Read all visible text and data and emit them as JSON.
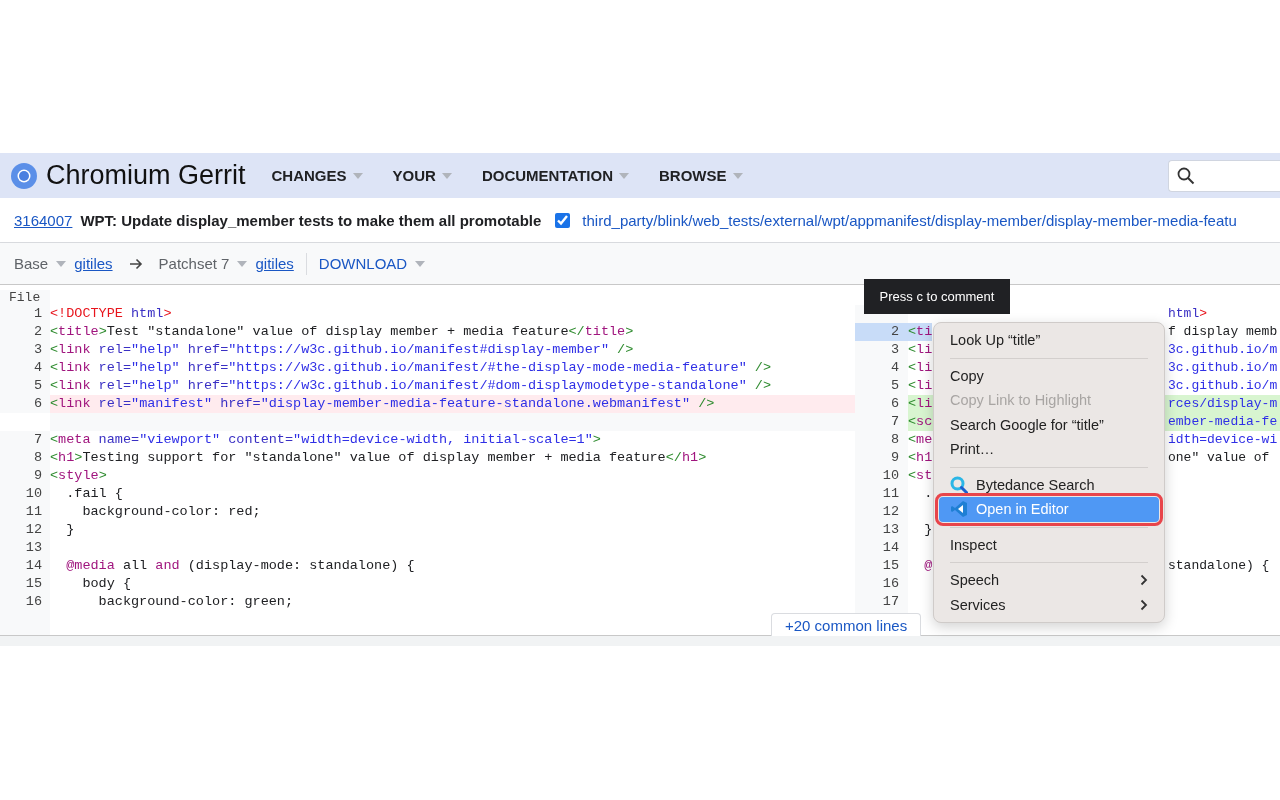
{
  "header": {
    "title": "Chromium Gerrit",
    "nav": [
      {
        "label": "CHANGES"
      },
      {
        "label": "YOUR"
      },
      {
        "label": "DOCUMENTATION"
      },
      {
        "label": "BROWSE"
      }
    ]
  },
  "change": {
    "number": "3164007",
    "subject": "WPT: Update display_member tests to make them all promotable",
    "reviewed": true,
    "path": "third_party/blink/web_tests/external/wpt/appmanifest/display-member/display-member-media-featu"
  },
  "toolbar": {
    "base": "Base",
    "base_link": "gitiles",
    "patchset": "Patchset 7",
    "patchset_link": "gitiles",
    "download": "DOWNLOAD"
  },
  "diff": {
    "file_label": "File",
    "expand_button": "+20 common lines",
    "left": [
      {
        "number": "1",
        "kind": "common",
        "tokens": [
          {
            "t": "<!DOCTYPE",
            "kind": "doctype"
          },
          {
            "t": " html",
            "kind": "attribute"
          },
          {
            "t": ">",
            "kind": "doctype"
          }
        ]
      },
      {
        "number": "2",
        "kind": "common",
        "tokens": [
          {
            "t": "<",
            "kind": "punctuation"
          },
          {
            "t": "title",
            "kind": "tag"
          },
          {
            "t": ">",
            "kind": "punctuation"
          },
          {
            "t": "Test \"standalone\" value of display member + media feature",
            "kind": "text"
          },
          {
            "t": "</",
            "kind": "punctuation"
          },
          {
            "t": "title",
            "kind": "tag"
          },
          {
            "t": ">",
            "kind": "punctuation"
          }
        ]
      },
      {
        "number": "3",
        "kind": "common",
        "tokens": [
          {
            "t": "<",
            "kind": "punctuation"
          },
          {
            "t": "link",
            "kind": "tag"
          },
          {
            "t": " rel=",
            "kind": "attribute"
          },
          {
            "t": "\"help\"",
            "kind": "string"
          },
          {
            "t": " href=",
            "kind": "attribute"
          },
          {
            "t": "\"https://w3c.github.io/manifest#display-member\"",
            "kind": "string"
          },
          {
            "t": " />",
            "kind": "punctuation"
          }
        ]
      },
      {
        "number": "4",
        "kind": "common",
        "tokens": [
          {
            "t": "<",
            "kind": "punctuation"
          },
          {
            "t": "link",
            "kind": "tag"
          },
          {
            "t": " rel=",
            "kind": "attribute"
          },
          {
            "t": "\"help\"",
            "kind": "string"
          },
          {
            "t": " href=",
            "kind": "attribute"
          },
          {
            "t": "\"https://w3c.github.io/manifest/#the-display-mode-media-feature\"",
            "kind": "string"
          },
          {
            "t": " />",
            "kind": "punctuation"
          }
        ]
      },
      {
        "number": "5",
        "kind": "common",
        "tokens": [
          {
            "t": "<",
            "kind": "punctuation"
          },
          {
            "t": "link",
            "kind": "tag"
          },
          {
            "t": " rel=",
            "kind": "attribute"
          },
          {
            "t": "\"help\"",
            "kind": "string"
          },
          {
            "t": " href=",
            "kind": "attribute"
          },
          {
            "t": "\"https://w3c.github.io/manifest/#dom-displaymodetype-standalone\"",
            "kind": "string"
          },
          {
            "t": " />",
            "kind": "punctuation"
          }
        ]
      },
      {
        "number": "6",
        "kind": "removed",
        "tokens": [
          {
            "t": "<",
            "kind": "punctuation"
          },
          {
            "t": "link",
            "kind": "tag"
          },
          {
            "t": " rel=",
            "kind": "attribute"
          },
          {
            "t": "\"manifest\"",
            "kind": "string"
          },
          {
            "t": " href=",
            "kind": "attribute"
          },
          {
            "t": "\"display-member-media-feature-standalone.webmanifest\"",
            "kind": "string"
          },
          {
            "t": " />",
            "kind": "punctuation"
          }
        ]
      },
      {
        "kind": "gap"
      },
      {
        "number": "7",
        "kind": "common",
        "tokens": [
          {
            "t": "<",
            "kind": "punctuation"
          },
          {
            "t": "meta",
            "kind": "tag"
          },
          {
            "t": " name=",
            "kind": "attribute"
          },
          {
            "t": "\"viewport\"",
            "kind": "string"
          },
          {
            "t": " content=",
            "kind": "attribute"
          },
          {
            "t": "\"width=device-width, initial-scale=1\"",
            "kind": "string"
          },
          {
            "t": ">",
            "kind": "punctuation"
          }
        ]
      },
      {
        "number": "8",
        "kind": "common",
        "tokens": [
          {
            "t": "<",
            "kind": "punctuation"
          },
          {
            "t": "h1",
            "kind": "tag"
          },
          {
            "t": ">",
            "kind": "punctuation"
          },
          {
            "t": "Testing support for \"standalone\" value of display member + media feature",
            "kind": "text"
          },
          {
            "t": "</",
            "kind": "punctuation"
          },
          {
            "t": "h1",
            "kind": "tag"
          },
          {
            "t": ">",
            "kind": "punctuation"
          }
        ]
      },
      {
        "number": "9",
        "kind": "common",
        "tokens": [
          {
            "t": "<",
            "kind": "punctuation"
          },
          {
            "t": "style",
            "kind": "tag"
          },
          {
            "t": ">",
            "kind": "punctuation"
          }
        ]
      },
      {
        "number": "10",
        "kind": "common",
        "tokens": [
          {
            "t": "  .fail {",
            "kind": "text"
          }
        ]
      },
      {
        "number": "11",
        "kind": "common",
        "tokens": [
          {
            "t": "    background-color: red;",
            "kind": "text"
          }
        ]
      },
      {
        "number": "12",
        "kind": "common",
        "tokens": [
          {
            "t": "  }",
            "kind": "text"
          }
        ]
      },
      {
        "number": "13",
        "kind": "common"
      },
      {
        "number": "14",
        "kind": "common",
        "tokens": [
          {
            "t": "  @media",
            "kind": "tag"
          },
          {
            "t": " all ",
            "kind": "text"
          },
          {
            "t": "and",
            "kind": "tag"
          },
          {
            "t": " (display-mode: standalone) {",
            "kind": "text"
          }
        ]
      },
      {
        "number": "15",
        "kind": "common",
        "tokens": [
          {
            "t": "    body {",
            "kind": "text"
          }
        ]
      },
      {
        "number": "16",
        "kind": "common",
        "tokens": [
          {
            "t": "      background-color: green;",
            "kind": "text"
          }
        ]
      }
    ],
    "right": [
      {
        "kind": "common",
        "selected": false,
        "tail": [
          {
            "t": "html",
            "kind": "attribute"
          },
          {
            "t": ">",
            "kind": "doctype"
          }
        ]
      },
      {
        "number": "2",
        "kind": "common",
        "selected": true,
        "lead": [
          {
            "t": "<",
            "kind": "punctuation"
          },
          {
            "t": "ti",
            "kind": "tag"
          }
        ],
        "tail": [
          {
            "t": "f display memb",
            "kind": "text"
          }
        ]
      },
      {
        "number": "3",
        "kind": "common",
        "selected": false,
        "lead": [
          {
            "t": "<",
            "kind": "punctuation"
          },
          {
            "t": "li",
            "kind": "tag"
          }
        ],
        "tail": [
          {
            "t": "3c.github.io/m",
            "kind": "string"
          }
        ]
      },
      {
        "number": "4",
        "kind": "common",
        "selected": false,
        "lead": [
          {
            "t": "<",
            "kind": "punctuation"
          },
          {
            "t": "li",
            "kind": "tag"
          }
        ],
        "tail": [
          {
            "t": "3c.github.io/m",
            "kind": "string"
          }
        ]
      },
      {
        "number": "5",
        "kind": "common",
        "selected": false,
        "lead": [
          {
            "t": "<",
            "kind": "punctuation"
          },
          {
            "t": "li",
            "kind": "tag"
          }
        ],
        "tail": [
          {
            "t": "3c.github.io/m",
            "kind": "string"
          }
        ]
      },
      {
        "number": "6",
        "kind": "added",
        "selected": false,
        "lead": [
          {
            "t": "<",
            "kind": "punctuation"
          },
          {
            "t": "li",
            "kind": "tag"
          }
        ],
        "tail": [
          {
            "t": "rces/display-m",
            "kind": "string"
          }
        ]
      },
      {
        "number": "7",
        "kind": "added",
        "selected": false,
        "lead": [
          {
            "t": "<",
            "kind": "punctuation"
          },
          {
            "t": "sc",
            "kind": "tag"
          }
        ],
        "tail": [
          {
            "t": "ember-media-fe",
            "kind": "string"
          }
        ]
      },
      {
        "number": "8",
        "kind": "common",
        "selected": false,
        "lead": [
          {
            "t": "<",
            "kind": "punctuation"
          },
          {
            "t": "me",
            "kind": "tag"
          }
        ],
        "tail": [
          {
            "t": "idth=device-wi",
            "kind": "string"
          }
        ]
      },
      {
        "number": "9",
        "kind": "common",
        "selected": false,
        "lead": [
          {
            "t": "<",
            "kind": "punctuation"
          },
          {
            "t": "h1",
            "kind": "tag"
          }
        ],
        "tail": [
          {
            "t": "one\" value of",
            "kind": "text"
          }
        ]
      },
      {
        "number": "10",
        "kind": "common",
        "selected": false,
        "lead": [
          {
            "t": "<",
            "kind": "punctuation"
          },
          {
            "t": "st",
            "kind": "tag"
          }
        ]
      },
      {
        "number": "11",
        "kind": "common",
        "selected": false,
        "lead": [
          {
            "t": "  .",
            "kind": "text"
          }
        ]
      },
      {
        "number": "12",
        "kind": "common",
        "selected": false
      },
      {
        "number": "13",
        "kind": "common",
        "selected": false,
        "lead": [
          {
            "t": "  }",
            "kind": "text"
          }
        ]
      },
      {
        "number": "14",
        "kind": "common",
        "selected": false
      },
      {
        "number": "15",
        "kind": "common",
        "selected": false,
        "lead": [
          {
            "t": "  @",
            "kind": "tag"
          }
        ],
        "tail": [
          {
            "t": "standalone) {",
            "kind": "text"
          }
        ]
      },
      {
        "number": "16",
        "kind": "common",
        "selected": false
      },
      {
        "number": "17",
        "kind": "common",
        "selected": false
      }
    ]
  },
  "tooltip": "Press c to comment",
  "context_menu": [
    {
      "kind": "item",
      "label": "Look Up “title”",
      "disabled": false,
      "selected": false
    },
    {
      "kind": "separator"
    },
    {
      "kind": "item",
      "label": "Copy",
      "disabled": false,
      "selected": false
    },
    {
      "kind": "item",
      "label": "Copy Link to Highlight",
      "disabled": true,
      "selected": false
    },
    {
      "kind": "item",
      "label": "Search Google for “title”",
      "disabled": false,
      "selected": false
    },
    {
      "kind": "item",
      "label": "Print…",
      "disabled": false,
      "selected": false
    },
    {
      "kind": "separator"
    },
    {
      "kind": "app",
      "label": "Bytedance Search",
      "disabled": false,
      "selected": false
    },
    {
      "kind": "app",
      "label": "Open in Editor",
      "disabled": false,
      "selected": true,
      "outlined": true
    },
    {
      "kind": "separator"
    },
    {
      "kind": "item",
      "label": "Inspect",
      "disabled": false,
      "selected": false
    },
    {
      "kind": "separator"
    },
    {
      "kind": "submenu",
      "label": "Speech",
      "disabled": false,
      "selected": false
    },
    {
      "kind": "submenu",
      "label": "Services",
      "disabled": false,
      "selected": false
    }
  ]
}
